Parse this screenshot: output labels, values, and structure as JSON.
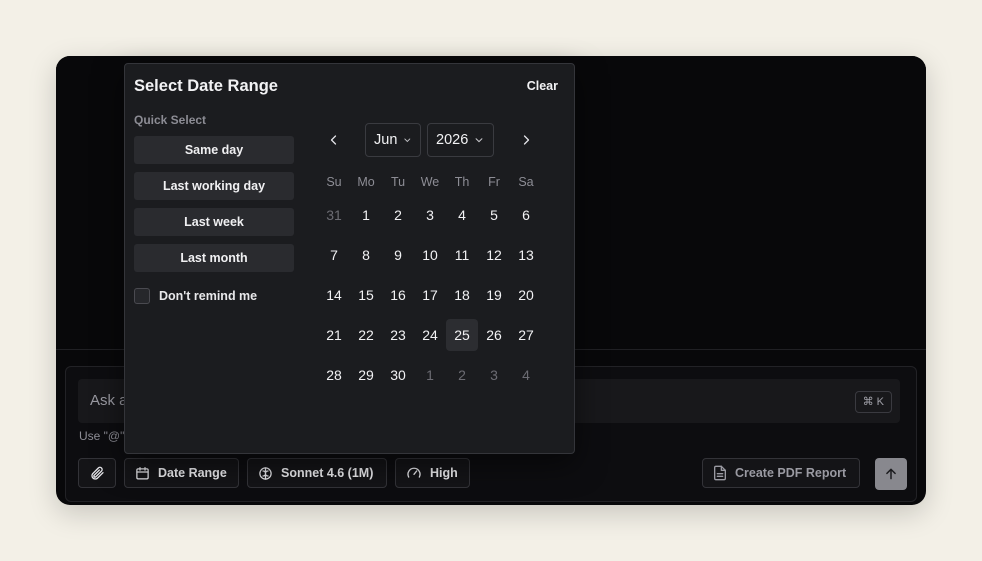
{
  "composer": {
    "placeholder": "Ask a",
    "shortcut": "⌘ K",
    "hint": "Use \"@\"",
    "toolbar": {
      "date_range_label": "Date Range",
      "model_label": "Sonnet 4.6 (1M)",
      "effort_label": "High",
      "pdf_label": "Create PDF Report"
    },
    "icons": {
      "attach": "paperclip-icon",
      "date": "calendar-icon",
      "model": "brain-icon",
      "effort": "gauge-icon",
      "pdf": "document-icon",
      "send": "arrow-up-icon"
    }
  },
  "date_picker": {
    "title": "Select Date Range",
    "clear_label": "Clear",
    "quick_select_label": "Quick Select",
    "quick_options": [
      "Same day",
      "Last working day",
      "Last week",
      "Last month"
    ],
    "dont_remind_label": "Don't remind me",
    "dont_remind_checked": false,
    "month": "Jun",
    "year": "2026",
    "weekdays": [
      "Su",
      "Mo",
      "Tu",
      "We",
      "Th",
      "Fr",
      "Sa"
    ],
    "weeks": [
      [
        "31",
        "1",
        "2",
        "3",
        "4",
        "5",
        "6"
      ],
      [
        "7",
        "8",
        "9",
        "10",
        "11",
        "12",
        "13"
      ],
      [
        "14",
        "15",
        "16",
        "17",
        "18",
        "19",
        "20"
      ],
      [
        "21",
        "22",
        "23",
        "24",
        "25",
        "26",
        "27"
      ],
      [
        "28",
        "29",
        "30",
        "1",
        "2",
        "3",
        "4"
      ]
    ],
    "outside_days": [
      [
        0,
        0
      ],
      [
        4,
        3
      ],
      [
        4,
        4
      ],
      [
        4,
        5
      ],
      [
        4,
        6
      ]
    ],
    "highlighted_day": "25"
  },
  "colors": {
    "page_background": "#f3f0e7",
    "window_background": "#08080a",
    "popup_background": "#1b1c1f",
    "send_button": "#88888e"
  }
}
